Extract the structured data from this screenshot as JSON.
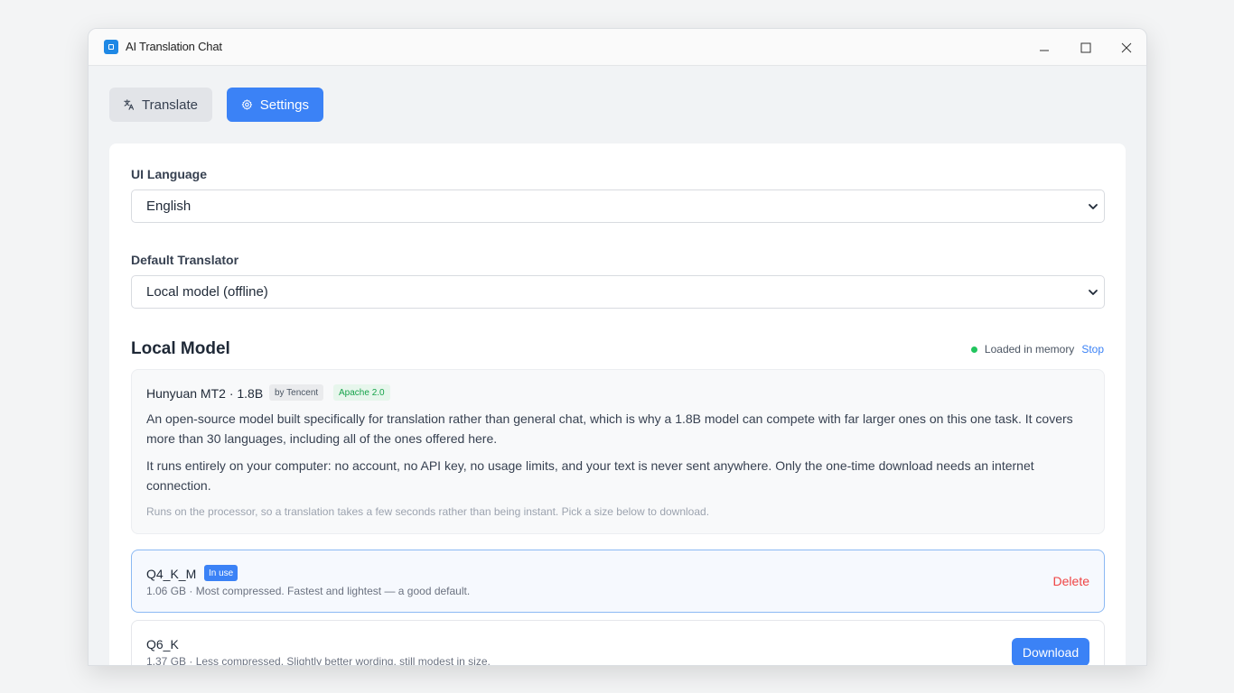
{
  "window": {
    "title": "AI Translation Chat"
  },
  "tabs": {
    "translate_label": "Translate",
    "settings_label": "Settings"
  },
  "settings": {
    "ui_language_label": "UI Language",
    "ui_language_value": "English",
    "default_translator_label": "Default Translator",
    "default_translator_value": "Local model (offline)"
  },
  "local_model": {
    "section_title": "Local Model",
    "status_text": "Loaded in memory",
    "stop_label": "Stop",
    "model_name": "Hunyuan MT2 · 1.8B",
    "vendor_badge": "by Tencent",
    "license_badge": "Apache 2.0",
    "description_1": "An open-source model built specifically for translation rather than general chat, which is why a 1.8B model can compete with far larger ones on this one task. It covers more than 30 languages, including all of the ones offered here.",
    "description_2": "It runs entirely on your computer: no account, no API key, no usage limits, and your text is never sent anywhere. Only the one-time download needs an internet connection.",
    "note": "Runs on the processor, so a translation takes a few seconds rather than being instant. Pick a size below to download."
  },
  "variants": [
    {
      "name": "Q4_K_M",
      "badge": "In use",
      "description": "1.06 GB · Most compressed. Fastest and lightest — a good default.",
      "action": "Delete"
    },
    {
      "name": "Q6_K",
      "description": "1.37 GB · Less compressed. Slightly better wording, still modest in size.",
      "action": "Download"
    }
  ],
  "colors": {
    "accent": "#3b82f6",
    "danger": "#ef4444",
    "success": "#22c55e"
  }
}
